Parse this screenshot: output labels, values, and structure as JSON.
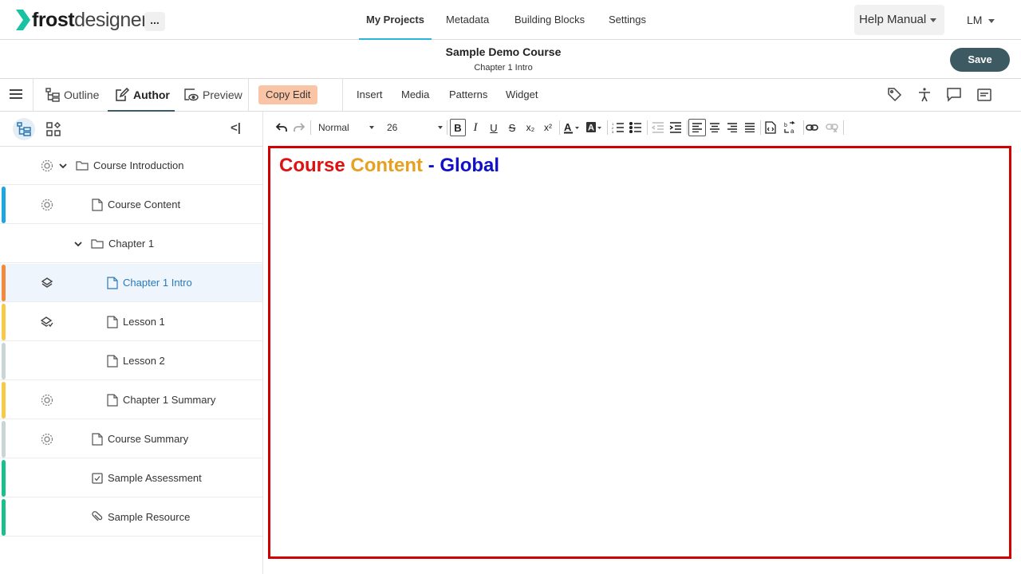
{
  "app": {
    "logo_bold": "frost",
    "logo_light": "designer",
    "more_label": "...",
    "nav": [
      "My Projects",
      "Metadata",
      "Building Blocks",
      "Settings"
    ],
    "help_label": "Help Manual",
    "user_label": "LM"
  },
  "course": {
    "title": "Sample Demo Course",
    "subtitle": "Chapter 1 Intro",
    "save_label": "Save"
  },
  "modes": {
    "outline": "Outline",
    "author": "Author",
    "preview": "Preview",
    "copy_edit": "Copy Edit",
    "menu": [
      "Insert",
      "Media",
      "Patterns",
      "Widget"
    ]
  },
  "toolbar": {
    "style_value": "Normal",
    "size_value": "26",
    "bold": "B",
    "italic": "I",
    "underline": "U",
    "strike": "S",
    "sub": "x₂",
    "sup": "x²"
  },
  "tree": [
    {
      "label": "Course Introduction",
      "type": "folder",
      "expanded": true,
      "status": "circle",
      "stripe": ""
    },
    {
      "label": "Course Content",
      "type": "page",
      "status": "circle",
      "stripe": "#1ea6e0"
    },
    {
      "label": "Chapter 1",
      "type": "folder",
      "expanded": true,
      "status": "",
      "stripe": ""
    },
    {
      "label": "Chapter 1 Intro",
      "type": "page",
      "status": "layers",
      "stripe": "#f08a3c",
      "selected": true
    },
    {
      "label": "Lesson 1",
      "type": "page",
      "status": "layers-check",
      "stripe": "#f7c948"
    },
    {
      "label": "Lesson 2",
      "type": "page",
      "status": "",
      "stripe": "#c9d6d6"
    },
    {
      "label": "Chapter 1 Summary",
      "type": "page",
      "status": "circle",
      "stripe": "#f7c948"
    },
    {
      "label": "Course Summary",
      "type": "page",
      "status": "circle",
      "stripe": "#c9d6d6"
    },
    {
      "label": "Sample Assessment",
      "type": "assessment",
      "status": "",
      "stripe": "#1bbf8f"
    },
    {
      "label": "Sample Resource",
      "type": "resource",
      "status": "",
      "stripe": "#1bbf8f"
    }
  ],
  "content": {
    "word1": "Course",
    "word2": "Content",
    "dash": "-",
    "word3": "Global"
  },
  "colors": {
    "accent": "#29b6d8",
    "save_bg": "#3d5a63",
    "copy_edit_bg": "#f9c5a6",
    "canvas_border": "#d00000",
    "heading_red": "#e01010",
    "heading_orange": "#e8a020",
    "heading_blue": "#1010c8"
  }
}
